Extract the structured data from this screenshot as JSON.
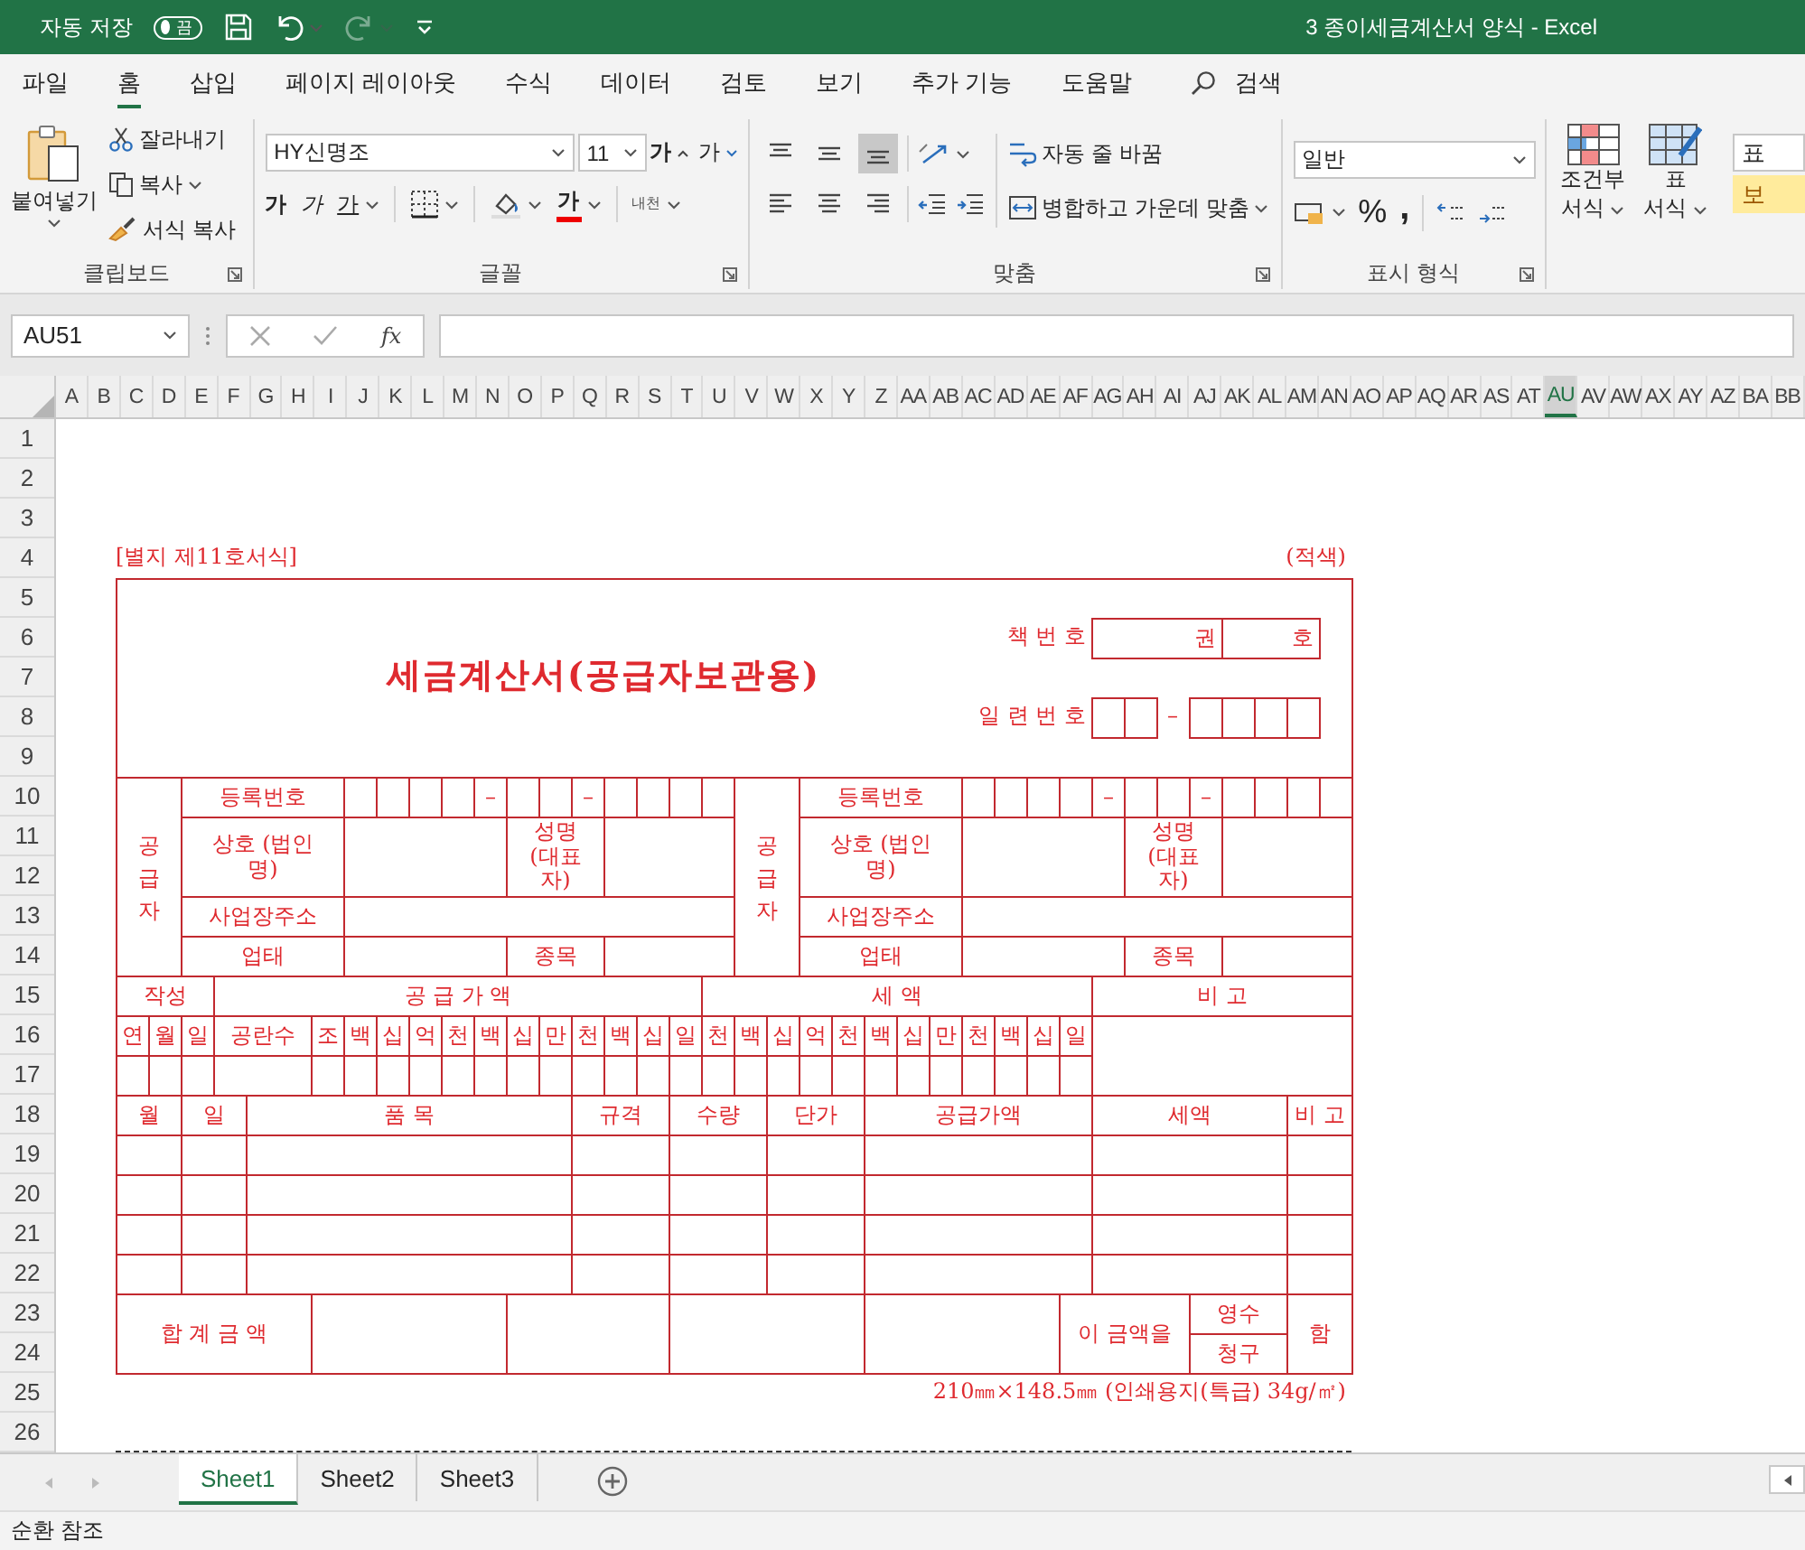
{
  "title_bar": {
    "autosave_label": "자동 저장",
    "autosave": {
      "label": "끔",
      "on": false
    },
    "redo": {
      "disabled": true
    },
    "document_title": "3 종이세금계산서 양식  -  Excel"
  },
  "ribbon_tabs": [
    {
      "label": "파일",
      "selected": false
    },
    {
      "label": "홈",
      "selected": true
    },
    {
      "label": "삽입",
      "selected": false
    },
    {
      "label": "페이지 레이아웃",
      "selected": false
    },
    {
      "label": "수식",
      "selected": false
    },
    {
      "label": "데이터",
      "selected": false
    },
    {
      "label": "검토",
      "selected": false
    },
    {
      "label": "보기",
      "selected": false
    },
    {
      "label": "추가 기능",
      "selected": false
    },
    {
      "label": "도움말",
      "selected": false
    }
  ],
  "search": {
    "label": "검색"
  },
  "clipboard": {
    "paste": "붙여넣기",
    "cut": "잘라내기",
    "copy": "복사",
    "format_painter": "서식 복사",
    "group_label": "클립보드"
  },
  "font": {
    "name": "HY신명조",
    "size": "11",
    "grow": "가",
    "shrink": "가",
    "bold": "가",
    "italic": "가",
    "underline": "가",
    "font_color": "가",
    "phonetic": "내천",
    "group_label": "글꼴"
  },
  "alignment": {
    "vertical": [
      {
        "selected": false
      },
      {
        "selected": false
      },
      {
        "selected": true
      }
    ],
    "horizontal": [
      {
        "selected": false
      },
      {
        "selected": false
      },
      {
        "selected": false
      }
    ],
    "wrap_text": "자동 줄 바꿈",
    "merge_center": "병합하고 가운데 맞춤",
    "group_label": "맞춤"
  },
  "number": {
    "format": "일반",
    "percent": "%",
    "comma": ",",
    "group_label": "표시 형식"
  },
  "styles": {
    "conditional_format": [
      "조건부",
      "서식"
    ],
    "format_table": [
      "표",
      "서식"
    ],
    "style_normal": "표",
    "style_neutral": "보"
  },
  "formula_bar": {
    "name_box": "AU51",
    "function_label": "fx"
  },
  "columns": [
    {
      "label": "A",
      "selected": false
    },
    {
      "label": "B",
      "selected": false
    },
    {
      "label": "C",
      "selected": false
    },
    {
      "label": "D",
      "selected": false
    },
    {
      "label": "E",
      "selected": false
    },
    {
      "label": "F",
      "selected": false
    },
    {
      "label": "G",
      "selected": false
    },
    {
      "label": "H",
      "selected": false
    },
    {
      "label": "I",
      "selected": false
    },
    {
      "label": "J",
      "selected": false
    },
    {
      "label": "K",
      "selected": false
    },
    {
      "label": "L",
      "selected": false
    },
    {
      "label": "M",
      "selected": false
    },
    {
      "label": "N",
      "selected": false
    },
    {
      "label": "O",
      "selected": false
    },
    {
      "label": "P",
      "selected": false
    },
    {
      "label": "Q",
      "selected": false
    },
    {
      "label": "R",
      "selected": false
    },
    {
      "label": "S",
      "selected": false
    },
    {
      "label": "T",
      "selected": false
    },
    {
      "label": "U",
      "selected": false
    },
    {
      "label": "V",
      "selected": false
    },
    {
      "label": "W",
      "selected": false
    },
    {
      "label": "X",
      "selected": false
    },
    {
      "label": "Y",
      "selected": false
    },
    {
      "label": "Z",
      "selected": false
    },
    {
      "label": "AA",
      "selected": false
    },
    {
      "label": "AB",
      "selected": false
    },
    {
      "label": "AC",
      "selected": false
    },
    {
      "label": "AD",
      "selected": false
    },
    {
      "label": "AE",
      "selected": false
    },
    {
      "label": "AF",
      "selected": false
    },
    {
      "label": "AG",
      "selected": false
    },
    {
      "label": "AH",
      "selected": false
    },
    {
      "label": "AI",
      "selected": false
    },
    {
      "label": "AJ",
      "selected": false
    },
    {
      "label": "AK",
      "selected": false
    },
    {
      "label": "AL",
      "selected": false
    },
    {
      "label": "AM",
      "selected": false
    },
    {
      "label": "AN",
      "selected": false
    },
    {
      "label": "AO",
      "selected": false
    },
    {
      "label": "AP",
      "selected": false
    },
    {
      "label": "AQ",
      "selected": false
    },
    {
      "label": "AR",
      "selected": false
    },
    {
      "label": "AS",
      "selected": false
    },
    {
      "label": "AT",
      "selected": false
    },
    {
      "label": "AU",
      "selected": true
    },
    {
      "label": "AV",
      "selected": false
    },
    {
      "label": "AW",
      "selected": false
    },
    {
      "label": "AX",
      "selected": false
    },
    {
      "label": "AY",
      "selected": false
    },
    {
      "label": "AZ",
      "selected": false
    },
    {
      "label": "BA",
      "selected": false
    },
    {
      "label": "BB",
      "selected": false
    }
  ],
  "rows": [
    "1",
    "2",
    "3",
    "4",
    "5",
    "6",
    "7",
    "8",
    "9",
    "10",
    "11",
    "12",
    "13",
    "14",
    "15",
    "16",
    "17",
    "18",
    "19",
    "20",
    "21",
    "22",
    "23",
    "24",
    "25",
    "26"
  ],
  "form": {
    "form_number": "[별지 제11호서식]",
    "color_note": "(적색)",
    "title": "세금계산서(공급자보관용)",
    "book_number": {
      "label": "책 번 호",
      "volume": "권",
      "number": "호"
    },
    "serial_number": {
      "label": "일 련 번 호",
      "dash": "–"
    },
    "parties": [
      {
        "side": "공급자",
        "registration": "등록번호",
        "reg_dashes": [
          "–",
          "–"
        ],
        "company": "상호 (법인명)",
        "representative": "성명 (대표자)",
        "address": "사업장주소",
        "business_type": "업태",
        "business_item": "종목"
      },
      {
        "side": "공급자",
        "registration": "등록번호",
        "reg_dashes": [
          "–",
          "–"
        ],
        "company": "상호 (법인명)",
        "representative": "성명 (대표자)",
        "address": "사업장주소",
        "business_type": "업태",
        "business_item": "종목"
      }
    ],
    "amounts": {
      "written": "작성",
      "supply_value": "공 급 가 액",
      "tax": "세 액",
      "remarks": "비 고",
      "date_units": [
        "연",
        "월",
        "일"
      ],
      "blank_count": "공란수",
      "supply_digits": [
        "조",
        "백",
        "십",
        "억",
        "천",
        "백",
        "십",
        "만",
        "천",
        "백",
        "십",
        "일"
      ],
      "tax_digits": [
        "천",
        "백",
        "십",
        "억",
        "천",
        "백",
        "십",
        "만",
        "천",
        "백",
        "십",
        "일"
      ]
    },
    "items": {
      "columns": [
        "월",
        "일",
        "품 목",
        "규격",
        "수량",
        "단가",
        "공급가액",
        "세액",
        "비 고"
      ]
    },
    "total": {
      "label": "합 계 금 액",
      "amount_phrase": "이 금액을",
      "receipt": "영수",
      "claim": "청구",
      "suffix": "함"
    },
    "paper_note": "210㎜×148.5㎜ (인쇄용지(특급) 34g/㎡)"
  },
  "sheet_tabs": [
    {
      "label": "Sheet1",
      "selected": true
    },
    {
      "label": "Sheet2",
      "selected": false
    },
    {
      "label": "Sheet3",
      "selected": false
    }
  ],
  "status_bar": {
    "text": "순환 참조"
  }
}
